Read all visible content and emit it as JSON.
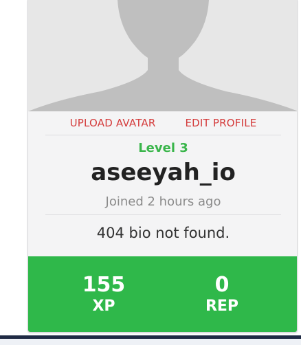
{
  "profile": {
    "actions": {
      "upload_avatar": "UPLOAD AVATAR",
      "edit_profile": "EDIT PROFILE"
    },
    "level": "Level 3",
    "username": "aseeyah_io",
    "joined": "Joined 2 hours ago",
    "bio": "404 bio not found."
  },
  "stats": {
    "xp_value": "155",
    "xp_label": "XP",
    "rep_value": "0",
    "rep_label": "REP"
  },
  "colors": {
    "accent_red": "#d43a3a",
    "level_green": "#39b54a",
    "stats_green": "#2fb84a"
  },
  "icons": {
    "avatar": "default-user-avatar"
  }
}
